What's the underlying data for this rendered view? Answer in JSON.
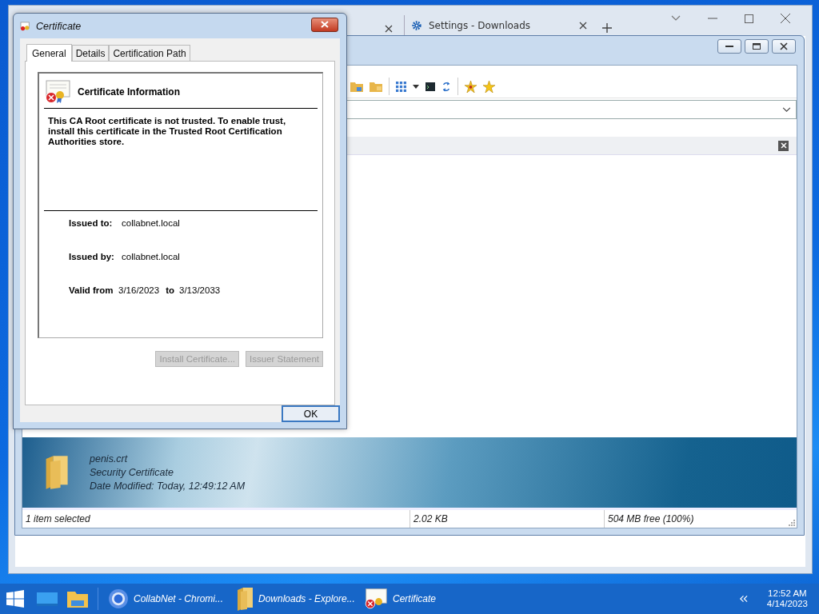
{
  "browser": {
    "tabs": [
      {
        "label": "Settings - Downloads",
        "selected": false
      }
    ]
  },
  "explorer": {
    "details": {
      "name": "penis.crt",
      "type": "Security Certificate",
      "modified": "Date Modified: Today, 12:49:12 AM"
    },
    "status_bar": [
      "1 item selected",
      "2.02 KB",
      "504 MB free (100%)"
    ]
  },
  "dialog": {
    "title": "Certificate",
    "tabs": [
      {
        "label": "General",
        "selected": true
      },
      {
        "label": "Details",
        "selected": false
      },
      {
        "label": "Certification Path",
        "selected": false
      }
    ],
    "heading": "Certificate Information",
    "message": "This CA Root certificate is not trusted. To enable trust, install this certificate in the Trusted Root Certification Authorities store.",
    "fields": [
      {
        "label": "Issued to:",
        "value": "collabnet.local"
      },
      {
        "label": "Issued by:",
        "value": "collabnet.local"
      }
    ],
    "validity": {
      "label": "Valid from",
      "from": "3/16/2023",
      "to_label": "to",
      "to": "3/13/2033"
    },
    "buttons": [
      {
        "label": "Install Certificate...",
        "disabled": true
      },
      {
        "label": "Issuer Statement",
        "disabled": true
      }
    ],
    "ok": "OK"
  },
  "taskbar": {
    "items": [
      {
        "kind": "browser",
        "label": "CollabNet - Chromi..."
      },
      {
        "kind": "folder",
        "label": "Downloads - Explore..."
      },
      {
        "kind": "certificate",
        "label": "Certificate"
      }
    ],
    "time": "12:52 AM",
    "date": "4/14/2023"
  }
}
